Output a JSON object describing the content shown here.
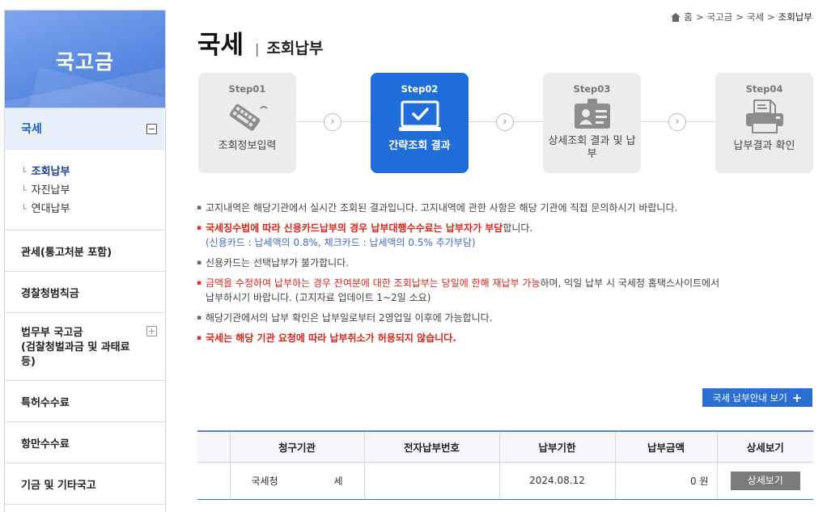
{
  "sidebar": {
    "title": "국고금",
    "active_section": "국세",
    "sub_items": [
      "조회납부",
      "자진납부",
      "연대납부"
    ],
    "items": [
      "관세(통고처분 포함)",
      "경찰청범칙금",
      "법무부 국고금\n(검찰청벌과금 및 과태료등)",
      "특허수수료",
      "항만수수료",
      "기금 및 기타국고"
    ]
  },
  "breadcrumb": [
    "홈",
    "국고금",
    "국세",
    "조회납부"
  ],
  "header": {
    "title": "국세",
    "subtitle": "조회납부"
  },
  "steps": [
    {
      "num": "Step01",
      "label": "조회정보입력",
      "icon": "keyboard-icon"
    },
    {
      "num": "Step02",
      "label": "간략조회 결과",
      "icon": "monitor-check-icon"
    },
    {
      "num": "Step03",
      "label": "상세조회 결과 및 납부",
      "icon": "id-card-icon"
    },
    {
      "num": "Step04",
      "label": "납부결과 확인",
      "icon": "printer-icon"
    }
  ],
  "notices": {
    "n1": "고지내역은 해당기관에서 실시간 조회된 결과입니다. 고지내역에 관한 사항은 해당 기관에 직접 문의하시기 바랍니다.",
    "n2_bold": "국세징수법에 따라 신용카드납부의 경우 납부대행수수료는 납부자가 부담",
    "n2_tail": "합니다.",
    "n2_blue": "(신용카드 : 납세액의 0.8%, 체크카드 : 납세액의 0.5% 추가부담)",
    "n3": "신용카드는 선택납부가 불가합니다.",
    "n4_red": "금액을 수정하여 납부하는 경우 잔여분에 대한 조회납부는 당일에 한해 재납부 가능",
    "n4_tail": "하며, 익일 납부 시 국세청 홈택스사이트에서",
    "n4_cont": "납부하시기 바랍니다. (고지자료 업데이트 1~2일 소요)",
    "n5": "해당기관에서의 납부 확인은 납부일로부터 2영업일 이후에 가능합니다.",
    "n6_bold": "국세는 해당 기관 요청에 따라 납부취소가 허용되지 않습니다."
  },
  "guide_button": {
    "label": "국세 납부안내 보기",
    "icon": "plus-icon"
  },
  "table": {
    "headers": [
      "",
      "청구기관",
      "전자납부번호",
      "납부기한",
      "납부금액",
      "상세보기"
    ],
    "row": {
      "agency": "국세청",
      "tax": "세",
      "number": "",
      "due": "2024.08.12",
      "amount": "0 원",
      "detail_label": "상세보기"
    }
  },
  "colors": {
    "accent": "#1f6dd8",
    "alert": "#d9261c",
    "sidebar_active": "#e8f0fc"
  }
}
